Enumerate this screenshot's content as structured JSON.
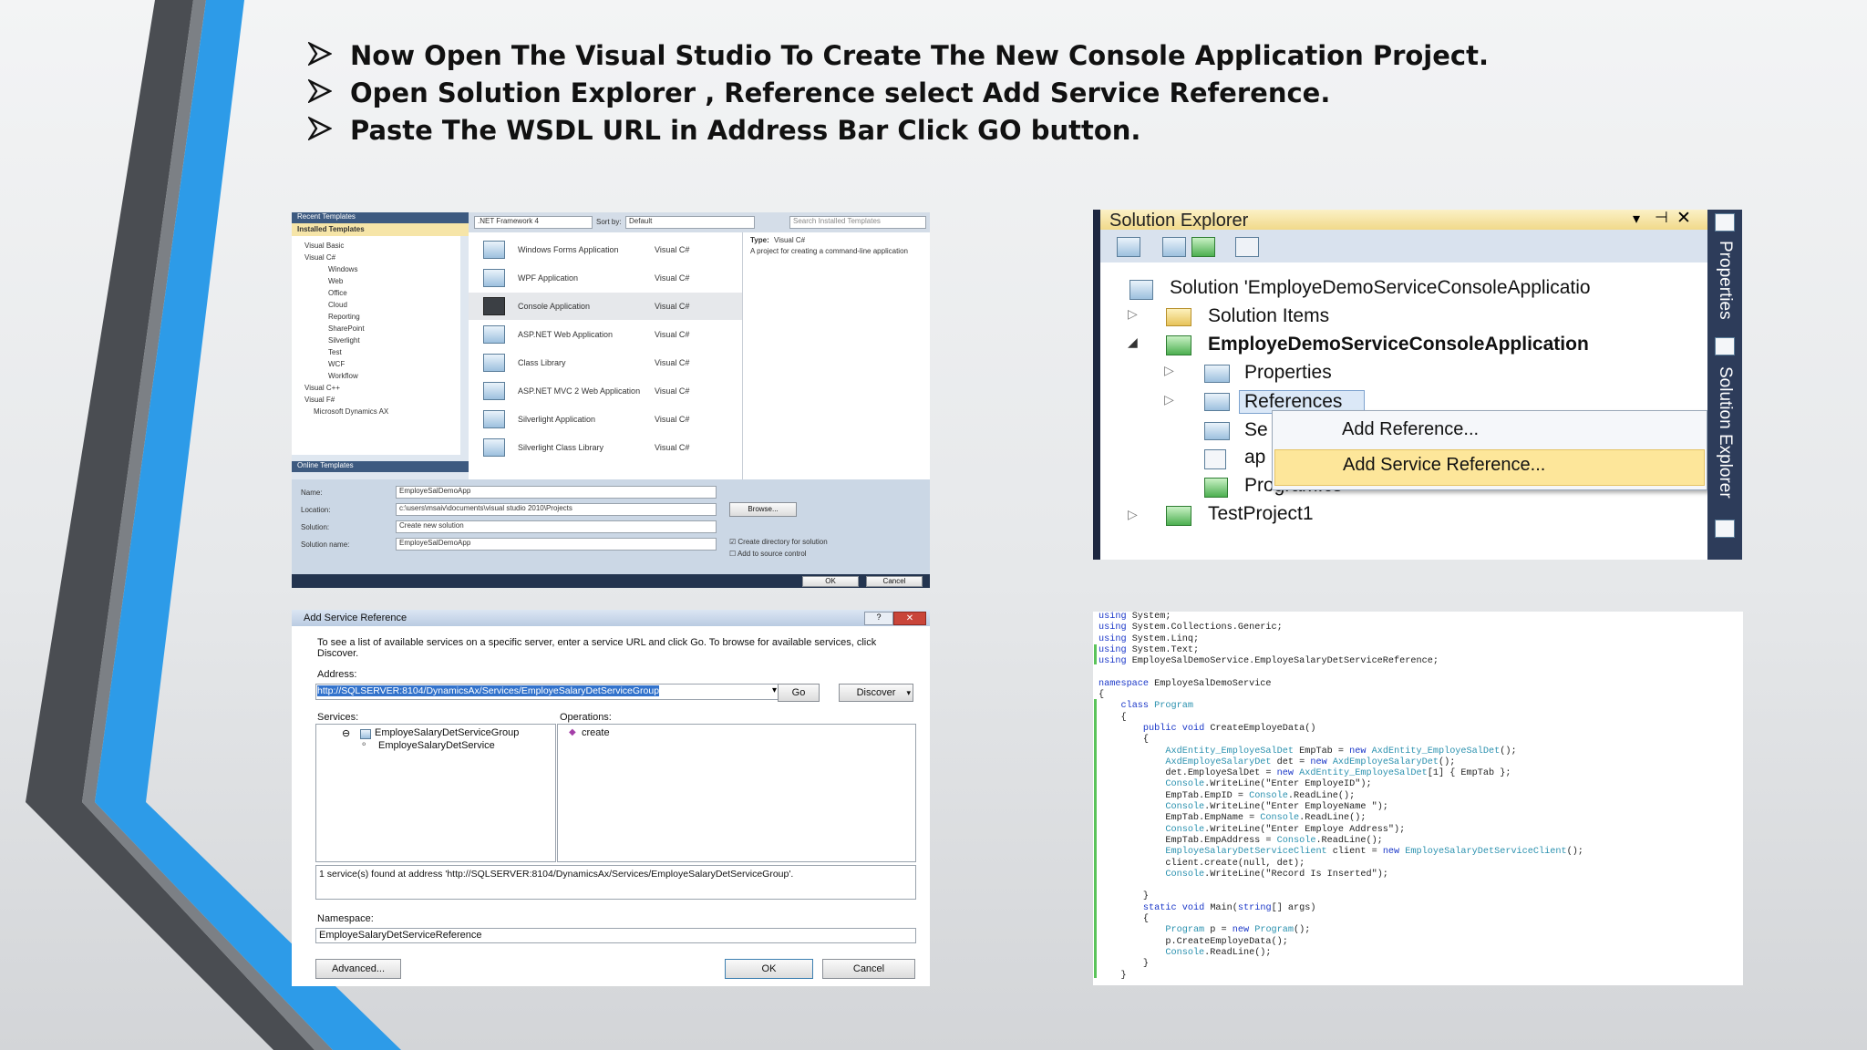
{
  "bullets": [
    "Now Open The Visual Studio To Create The New Console Application Project.",
    "Open Solution Explorer  , Reference select Add Service Reference.",
    "Paste The WSDL URL in Address Bar Click GO button."
  ],
  "new_project": {
    "recent_header": "Recent Templates",
    "installed_header": "Installed Templates",
    "framework": ".NET Framework 4",
    "sort_label": "Sort by:",
    "sort_value": "Default",
    "search_placeholder": "Search Installed Templates",
    "tree": [
      "Visual Basic",
      "Visual C#",
      "Windows",
      "Web",
      "Office",
      "Cloud",
      "Reporting",
      "SharePoint",
      "Silverlight",
      "Test",
      "WCF",
      "Workflow",
      "Visual C++",
      "Visual F#",
      "Microsoft Dynamics AX"
    ],
    "online_header": "Online Templates",
    "templates": [
      {
        "name": "Windows Forms Application",
        "lang": "Visual C#"
      },
      {
        "name": "WPF Application",
        "lang": "Visual C#"
      },
      {
        "name": "Console Application",
        "lang": "Visual C#"
      },
      {
        "name": "ASP.NET Web Application",
        "lang": "Visual C#"
      },
      {
        "name": "Class Library",
        "lang": "Visual C#"
      },
      {
        "name": "ASP.NET MVC 2 Web Application",
        "lang": "Visual C#"
      },
      {
        "name": "Silverlight Application",
        "lang": "Visual C#"
      },
      {
        "name": "Silverlight Class Library",
        "lang": "Visual C#"
      }
    ],
    "type_label": "Type:",
    "type_value": "Visual C#",
    "description": "A project for creating a command-line application",
    "form": {
      "name_label": "Name:",
      "name_value": "EmployeSalDemoApp",
      "location_label": "Location:",
      "location_value": "c:\\users\\msaiv\\documents\\visual studio 2010\\Projects",
      "solution_label": "Solution:",
      "solution_value": "Create new solution",
      "solution_name_label": "Solution name:",
      "solution_name_value": "EmployeSalDemoApp"
    },
    "browse": "Browse...",
    "create_dir": "Create directory for solution",
    "source_control": "Add to source control",
    "ok": "OK",
    "cancel": "Cancel"
  },
  "solution_explorer": {
    "title": "Solution Explorer",
    "solution": "Solution 'EmployeDemoServiceConsoleApplicatio",
    "solution_items": "Solution Items",
    "project": "EmployeDemoServiceConsoleApplication",
    "properties": "Properties",
    "references": "References",
    "se_partial": "Se",
    "ap_partial": "ap",
    "program": "Program.cs",
    "test_project": "TestProject1",
    "menu_add_reference": "Add Reference...",
    "menu_add_service_reference": "Add Service Reference...",
    "side_tab_properties": "Properties",
    "side_tab_solution": "Solution Explorer"
  },
  "add_service_ref": {
    "title": "Add Service Reference",
    "instructions": "To see a list of available services on a specific server, enter a service URL and click Go. To browse for available services, click Discover.",
    "address_label": "Address:",
    "address_value": "http://SQLSERVER:8104/DynamicsAx/Services/EmployeSalaryDetServiceGroup",
    "go": "Go",
    "discover": "Discover",
    "services_label": "Services:",
    "operations_label": "Operations:",
    "service_group": "EmployeSalaryDetServiceGroup",
    "service": "EmployeSalaryDetService",
    "operation": "create",
    "status": "1 service(s) found at address 'http://SQLSERVER:8104/DynamicsAx/Services/EmployeSalaryDetServiceGroup'.",
    "namespace_label": "Namespace:",
    "namespace_value": "EmployeSalaryDetServiceReference",
    "advanced": "Advanced...",
    "ok": "OK",
    "cancel": "Cancel"
  },
  "code": {
    "lines": [
      "using System;",
      "using System.Collections.Generic;",
      "using System.Linq;",
      "using System.Text;",
      "using EmployeSalDemoService.EmployeSalaryDetServiceReference;",
      "",
      "namespace EmployeSalDemoService",
      "{",
      "    class Program",
      "    {",
      "        public void CreateEmployeData()",
      "        {",
      "            AxdEntity_EmployeSalDet EmpTab = new AxdEntity_EmployeSalDet();",
      "            AxdEmployeSalaryDet det = new AxdEmployeSalaryDet();",
      "            det.EmployeSalDet = new AxdEntity_EmployeSalDet[1] { EmpTab };",
      "            Console.WriteLine(\"Enter EmployeID\");",
      "            EmpTab.EmpID = Console.ReadLine();",
      "            Console.WriteLine(\"Enter EmployeName \");",
      "            EmpTab.EmpName = Console.ReadLine();",
      "            Console.WriteLine(\"Enter Employe Address\");",
      "            EmpTab.EmpAddress = Console.ReadLine();",
      "            EmployeSalaryDetServiceClient client = new EmployeSalaryDetServiceClient();",
      "            client.create(null, det);",
      "            Console.WriteLine(\"Record Is Inserted\");",
      "",
      "        }",
      "        static void Main(string[] args)",
      "        {",
      "            Program p = new Program();",
      "            p.CreateEmployeData();",
      "            Console.ReadLine();",
      "        }",
      "    }"
    ]
  }
}
